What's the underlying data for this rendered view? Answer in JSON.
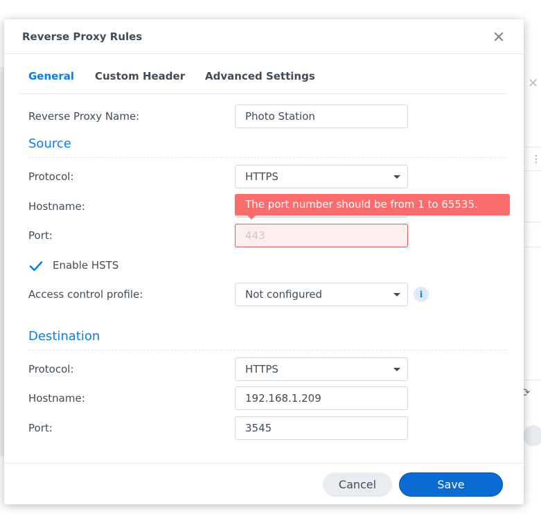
{
  "dialog": {
    "title": "Reverse Proxy Rules"
  },
  "tabs": [
    {
      "label": "General",
      "active": true
    },
    {
      "label": "Custom Header",
      "active": false
    },
    {
      "label": "Advanced Settings",
      "active": false
    }
  ],
  "general": {
    "name_label": "Reverse Proxy Name:",
    "name_value": "Photo Station"
  },
  "source": {
    "section_title": "Source",
    "protocol_label": "Protocol:",
    "protocol_value": "HTTPS",
    "hostname_label": "Hostname:",
    "port_label": "Port:",
    "port_placeholder": "443",
    "port_error": "The port number should be from 1 to 65535.",
    "hsts_label": "Enable HSTS",
    "hsts_checked": true,
    "access_label": "Access control profile:",
    "access_value": "Not configured"
  },
  "destination": {
    "section_title": "Destination",
    "protocol_label": "Protocol:",
    "protocol_value": "HTTPS",
    "hostname_label": "Hostname:",
    "hostname_value": "192.168.1.209",
    "port_label": "Port:",
    "port_value": "3545"
  },
  "footer": {
    "cancel_label": "Cancel",
    "save_label": "Save"
  },
  "colors": {
    "accent": "#057feb",
    "error": "#fb6d6d",
    "save_button": "#0a6bd2"
  },
  "icons": [
    "close-icon",
    "chevron-down-icon",
    "checkmark-icon",
    "info-icon"
  ]
}
